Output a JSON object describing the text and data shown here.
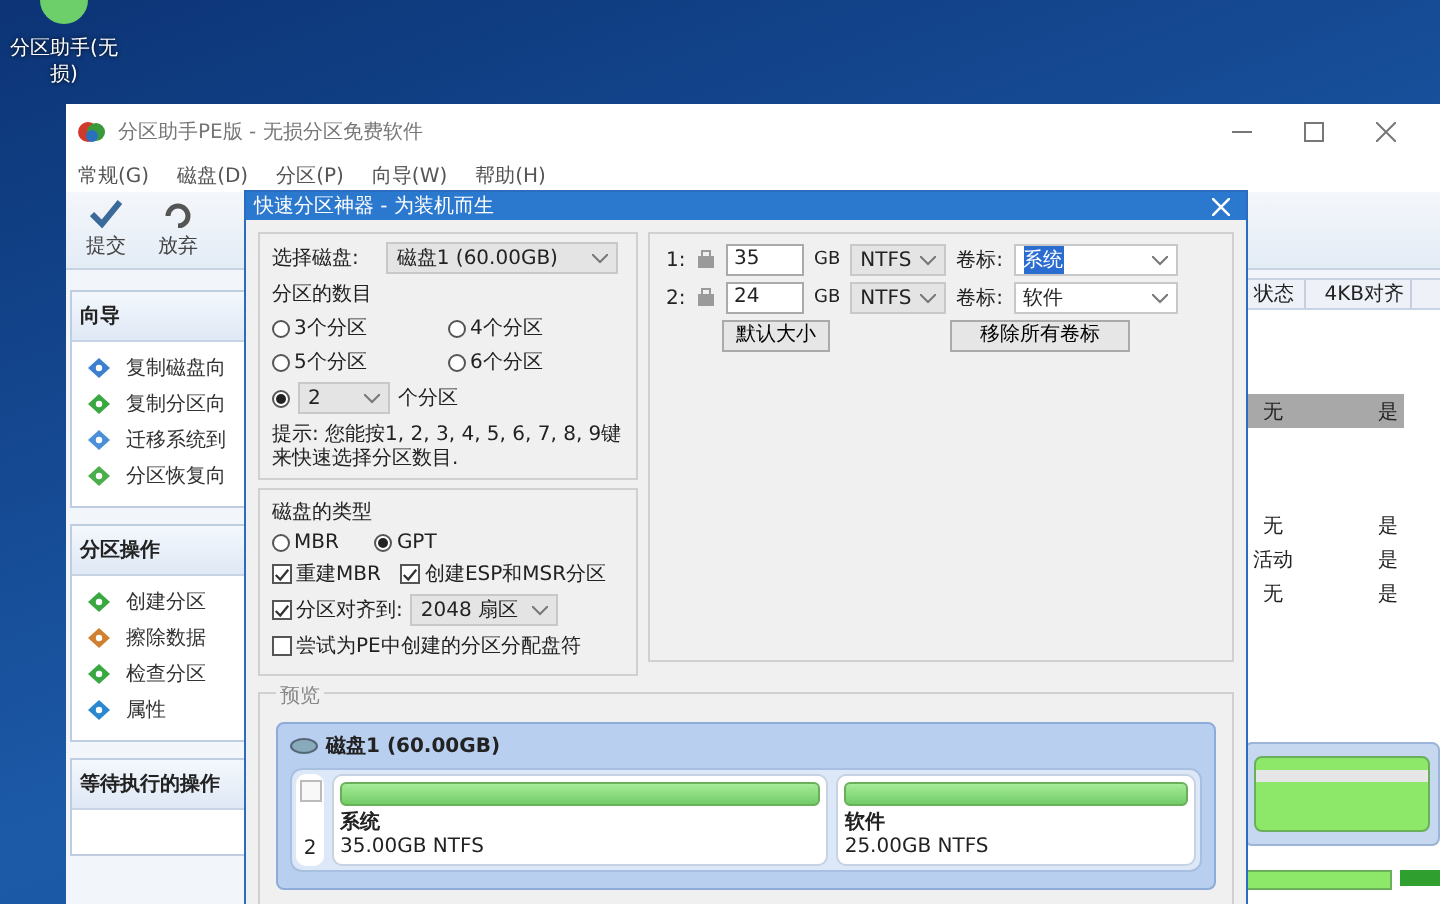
{
  "desktop_icon": {
    "label": "分区助手(无损)"
  },
  "main_window": {
    "title": "分区助手PE版 - 无损分区免费软件",
    "menu": [
      "常规(G)",
      "磁盘(D)",
      "分区(P)",
      "向导(W)",
      "帮助(H)"
    ],
    "toolbar": [
      {
        "kind": "commit",
        "label": "提交"
      },
      {
        "kind": "discard",
        "label": "放弃"
      }
    ],
    "sidebar": [
      {
        "title": "向导",
        "items": [
          {
            "label": "复制磁盘向"
          },
          {
            "label": "复制分区向"
          },
          {
            "label": "迁移系统到"
          },
          {
            "label": "分区恢复向"
          }
        ]
      },
      {
        "title": "分区操作",
        "items": [
          {
            "label": "创建分区"
          },
          {
            "label": "擦除数据"
          },
          {
            "label": "检查分区"
          },
          {
            "label": "属性"
          }
        ]
      },
      {
        "title": "等待执行的操作"
      }
    ],
    "table": {
      "columns": [
        "状态",
        "4KB对齐"
      ],
      "groups": [
        {
          "rows": [
            {
              "cells": [
                "无",
                "是"
              ],
              "selected": true
            }
          ]
        },
        {
          "rows": [
            {
              "cells": [
                "无",
                "是"
              ],
              "selected": false
            },
            {
              "cells": [
                "活动",
                "是"
              ],
              "selected": false
            },
            {
              "cells": [
                "无",
                "是"
              ],
              "selected": false
            }
          ]
        }
      ]
    }
  },
  "dialog": {
    "title": "快速分区神器 - 为装机而生",
    "select_disk": {
      "label": "选择磁盘:",
      "value": "磁盘1 (60.00GB)"
    },
    "count": {
      "label": "分区的数目",
      "options": [
        {
          "kind": "fixed",
          "label": "3个分区",
          "selected": false
        },
        {
          "kind": "fixed",
          "label": "4个分区",
          "selected": false
        },
        {
          "kind": "fixed",
          "label": "5个分区",
          "selected": false
        },
        {
          "kind": "fixed",
          "label": "6个分区",
          "selected": false
        },
        {
          "kind": "custom",
          "value": "2",
          "suffix": "个分区",
          "selected": true
        }
      ]
    },
    "hint": "提示: 您能按1, 2, 3, 4, 5, 6, 7, 8, 9键来快速选择分区数目.",
    "disk_type": {
      "label": "磁盘的类型",
      "options": [
        {
          "label": "MBR",
          "selected": false
        },
        {
          "label": "GPT",
          "selected": true
        }
      ]
    },
    "checks": [
      {
        "kind": "plain",
        "label": "重建MBR",
        "checked": true
      },
      {
        "kind": "plain",
        "label": "创建ESP和MSR分区",
        "checked": true
      },
      {
        "kind": "align",
        "label": "分区对齐到:",
        "checked": true,
        "value": "2048 扇区"
      },
      {
        "kind": "plain",
        "label": "尝试为PE中创建的分区分配盘符",
        "checked": false
      }
    ],
    "partitions": [
      {
        "index": "1:",
        "size": "35",
        "unit": "GB",
        "fs": "NTFS",
        "label_caption": "卷标:",
        "label": "系统",
        "highlighted": true
      },
      {
        "index": "2:",
        "size": "24",
        "unit": "GB",
        "fs": "NTFS",
        "label_caption": "卷标:",
        "label": "软件",
        "highlighted": false
      }
    ],
    "buttons": [
      "默认大小",
      "移除所有卷标"
    ],
    "preview": {
      "title": "预览",
      "disk": "磁盘1 (60.00GB)",
      "count": "2",
      "checked": false,
      "partitions": [
        {
          "name": "系统",
          "detail": "35.00GB NTFS"
        },
        {
          "name": "软件",
          "detail": "25.00GB NTFS"
        }
      ]
    }
  }
}
